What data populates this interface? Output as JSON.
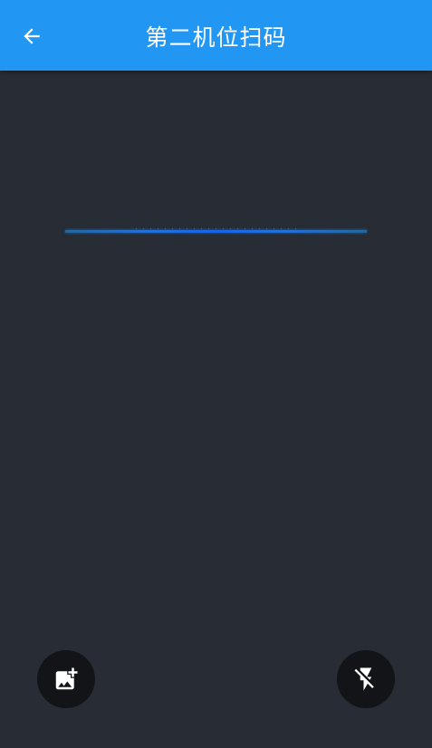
{
  "app_bar": {
    "title": "第二机位扫码",
    "background_color": "#2196f3",
    "back_icon": "arrow-back-icon"
  },
  "scanner": {
    "background_color": "#272c35",
    "scan_line_color": "#1e6fe8"
  },
  "actions": {
    "gallery_icon": "add-photo-icon",
    "flash_icon": "flash-off-icon",
    "button_color": "#121418"
  }
}
